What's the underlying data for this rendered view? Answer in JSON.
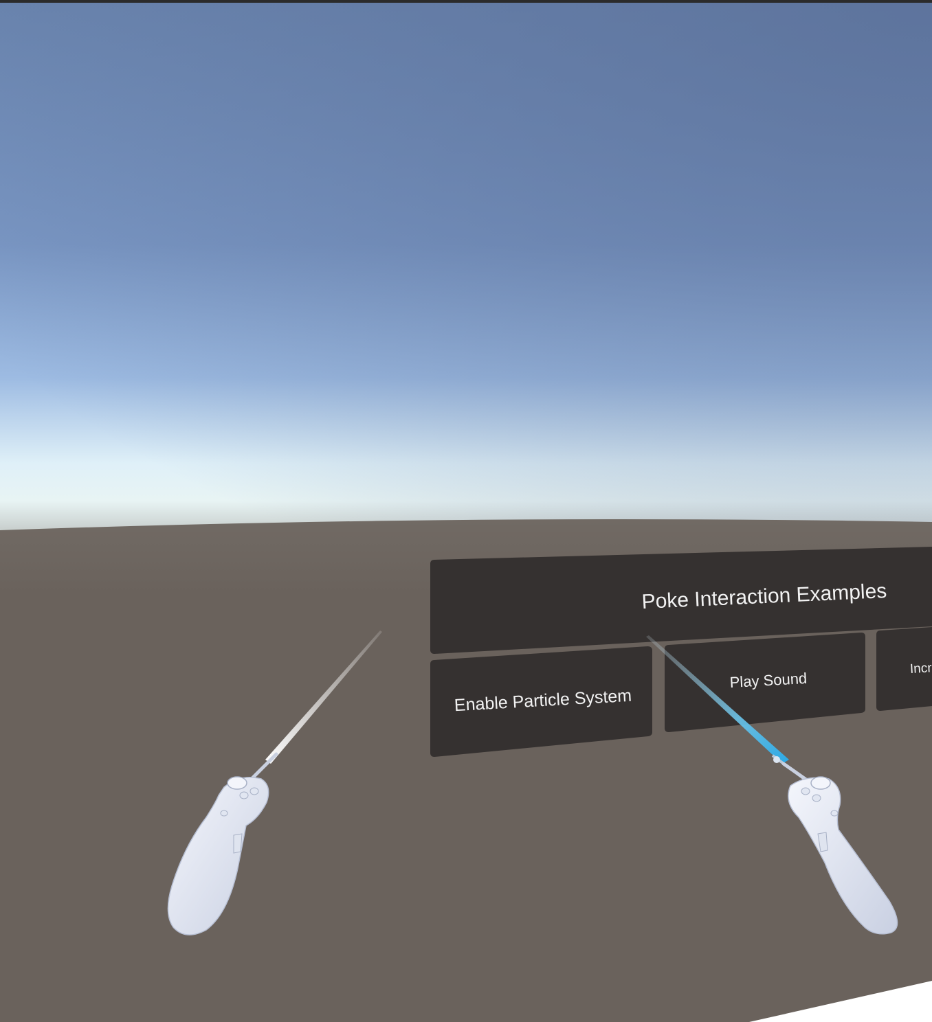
{
  "scene": {
    "panel": {
      "title": "Poke Interaction Examples",
      "buttons": [
        {
          "label": "Enable Particle System"
        },
        {
          "label": "Play Sound"
        },
        {
          "label": "Incre"
        }
      ]
    },
    "colors": {
      "sky_top": "#5f78a0",
      "sky_horizon": "#e6f2f6",
      "ground": "#6a625c",
      "panel": "#353130",
      "ray_active": "#3fb6ea",
      "controller": "#e8ecf6"
    },
    "icons": [
      "left-controller-icon",
      "right-controller-icon"
    ]
  }
}
